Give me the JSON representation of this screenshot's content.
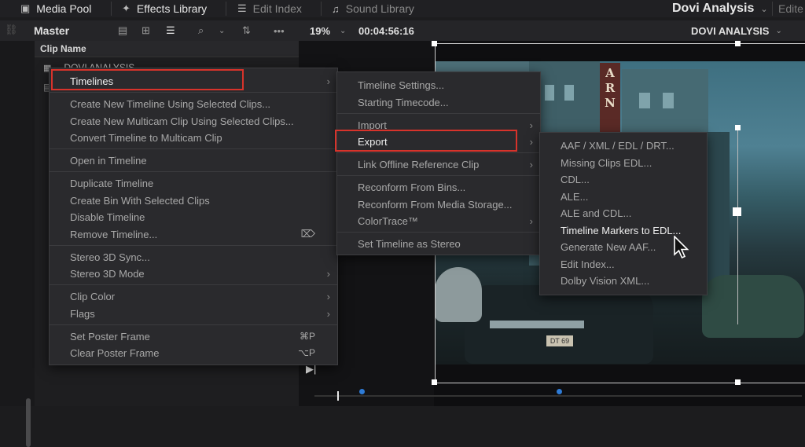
{
  "topbar": {
    "media_pool": "Media Pool",
    "effects_library": "Effects Library",
    "edit_index": "Edit Index",
    "sound_library": "Sound Library",
    "project_name": "Dovi Analysis",
    "edit_truncated": "Edite"
  },
  "toolbar": {
    "bin": "Master",
    "zoom": "19%",
    "timecode": "00:04:56:16",
    "timeline_name": "DOVI ANALYSIS"
  },
  "bin": {
    "column_header": "Clip Name",
    "clip_name": "DOVI ANALYSIS"
  },
  "context_menu": {
    "items": [
      {
        "label": "Timelines"
      },
      {
        "label": "Create New Timeline Using Selected Clips..."
      },
      {
        "label": "Create New Multicam Clip Using Selected Clips..."
      },
      {
        "label": "Convert Timeline to Multicam Clip"
      },
      {
        "label": "Open in Timeline"
      },
      {
        "label": "Duplicate Timeline"
      },
      {
        "label": "Create Bin With Selected Clips"
      },
      {
        "label": "Disable Timeline"
      },
      {
        "label": "Remove Timeline..."
      },
      {
        "label": "Stereo 3D Sync..."
      },
      {
        "label": "Stereo 3D Mode"
      },
      {
        "label": "Clip Color"
      },
      {
        "label": "Flags"
      },
      {
        "label": "Set Poster Frame",
        "shortcut": "⌘P"
      },
      {
        "label": "Clear Poster Frame",
        "shortcut": "⌥P"
      }
    ]
  },
  "timelines_menu": {
    "items": [
      {
        "label": "Timeline Settings..."
      },
      {
        "label": "Starting Timecode..."
      },
      {
        "label": "Import"
      },
      {
        "label": "Export"
      },
      {
        "label": "Link Offline Reference Clip"
      },
      {
        "label": "Reconform From Bins..."
      },
      {
        "label": "Reconform From Media Storage..."
      },
      {
        "label": "ColorTrace™"
      },
      {
        "label": "Set Timeline as Stereo"
      }
    ]
  },
  "export_menu": {
    "items": [
      {
        "label": "AAF / XML / EDL / DRT..."
      },
      {
        "label": "Missing Clips EDL..."
      },
      {
        "label": "CDL..."
      },
      {
        "label": "ALE..."
      },
      {
        "label": "ALE and CDL..."
      },
      {
        "label": "Timeline Markers to EDL..."
      },
      {
        "label": "Generate New AAF..."
      },
      {
        "label": "Edit Index..."
      },
      {
        "label": "Dolby Vision XML..."
      }
    ]
  },
  "viewer": {
    "sign_letters": [
      "A",
      "R",
      "N"
    ],
    "plate_text": "DT 69"
  },
  "colors": {
    "highlight_outline": "#d7332b",
    "marker_blue": "#2e7bd6"
  }
}
